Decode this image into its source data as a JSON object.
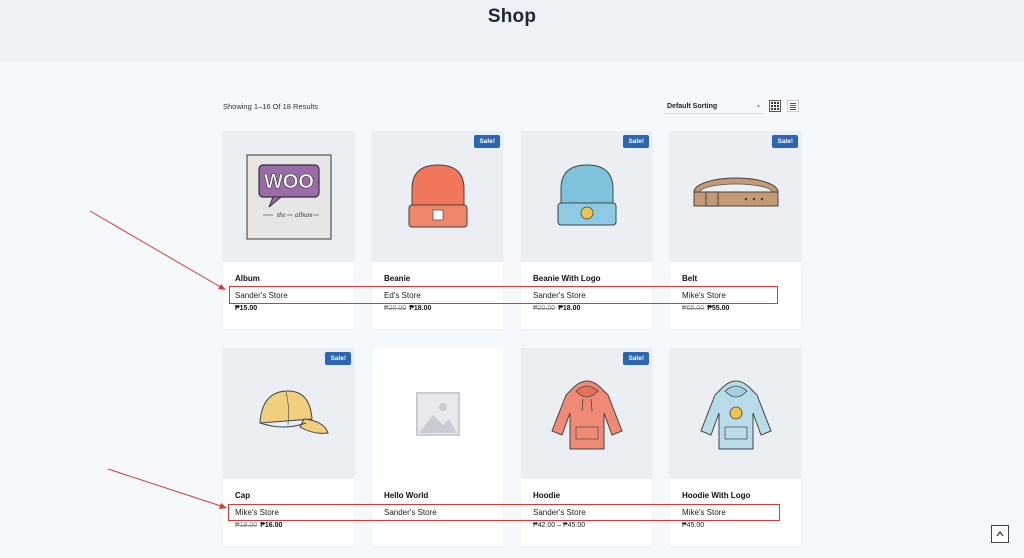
{
  "page": {
    "title": "Shop"
  },
  "toolbar": {
    "result_count": "Showing 1–16 Of 18 Results",
    "sorting_selected": "Default Sorting"
  },
  "products": [
    {
      "name": "Album",
      "store": "Sander's Store",
      "old_price": "",
      "price": "₱15.00",
      "sale": "",
      "image": "album-illustration"
    },
    {
      "name": "Beanie",
      "store": "Ed's Store",
      "old_price": "₱20.00",
      "price": "₱18.00",
      "sale": "Sale!",
      "image": "beanie-illustration"
    },
    {
      "name": "Beanie With Logo",
      "store": "Sander's Store",
      "old_price": "₱20.00",
      "price": "₱18.00",
      "sale": "Sale!",
      "image": "beanie-logo-illustration"
    },
    {
      "name": "Belt",
      "store": "Mike's Store",
      "old_price": "₱65.00",
      "price": "₱55.00",
      "sale": "Sale!",
      "image": "belt-illustration"
    },
    {
      "name": "Cap",
      "store": "Mike's Store",
      "old_price": "₱18.00",
      "price": "₱16.00",
      "sale": "Sale!",
      "image": "cap-illustration"
    },
    {
      "name": "Hello World",
      "store": "Sander's Store",
      "old_price": "",
      "price": "",
      "sale": "",
      "image": "placeholder-image"
    },
    {
      "name": "Hoodie",
      "store": "Sander's Store",
      "old_price": "",
      "price": "₱42.00 – ₱45.00",
      "sale": "Sale!",
      "image": "hoodie-illustration"
    },
    {
      "name": "Hoodie With Logo",
      "store": "Mike's Store",
      "old_price": "",
      "price": "₱45.00",
      "sale": "",
      "image": "hoodie-logo-illustration"
    }
  ],
  "album_art": {
    "logo_text": "WOO",
    "sub_left": "the",
    "sub_right": "album"
  },
  "colors": {
    "sale_badge": "#2a66b3",
    "annotation": "#d63a3a",
    "image_bg": "#ebeef2"
  }
}
